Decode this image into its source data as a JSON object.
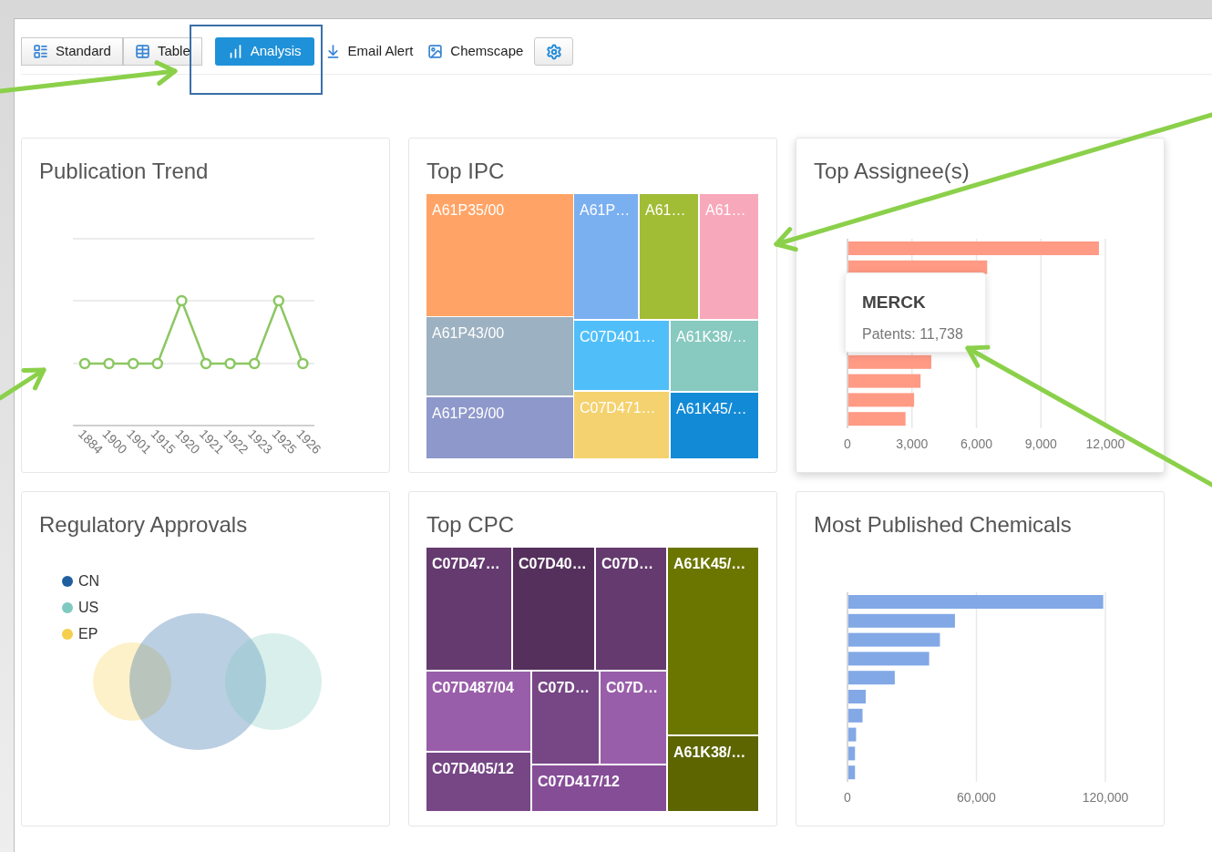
{
  "toolbar": {
    "tabs": [
      {
        "label": "Standard",
        "kind": "segment",
        "selected": false
      },
      {
        "label": "Table",
        "kind": "segment",
        "selected": false
      },
      {
        "label": "Analysis",
        "kind": "segment",
        "selected": true
      },
      {
        "label": "Email Alert",
        "kind": "link",
        "selected": false
      },
      {
        "label": "Chemscape",
        "kind": "link",
        "selected": false
      }
    ]
  },
  "cards": [
    {
      "kind": "line",
      "title": "Publication Trend",
      "x_labels": [
        "1884",
        "1900",
        "1901",
        "1915",
        "1920",
        "1921",
        "1922",
        "1923",
        "1925",
        "1926"
      ]
    },
    {
      "kind": "treemap",
      "title": "Top IPC",
      "bold_labels": false,
      "cells": [
        {
          "label": "A61P35/00",
          "color": "#ffa466"
        },
        {
          "label": "A61P…",
          "color": "#7aaff0"
        },
        {
          "label": "A61…",
          "color": "#a1bc35"
        },
        {
          "label": "A61…",
          "color": "#f8a8bb"
        },
        {
          "label": "A61P43/00",
          "color": "#9cb1c1"
        },
        {
          "label": "A61P29/00",
          "color": "#8e98cb"
        },
        {
          "label": "C07D401…",
          "color": "#50bff9"
        },
        {
          "label": "A61K38/…",
          "color": "#88c9c0"
        },
        {
          "label": "C07D471…",
          "color": "#f4d26f"
        },
        {
          "label": "A61K45/…",
          "color": "#138ad6"
        }
      ]
    },
    {
      "kind": "bar",
      "title": "Top Assignee(s)",
      "chart_data": {
        "type": "bar",
        "orientation": "horizontal",
        "grid": true,
        "series": [
          {
            "color": "#ff9a85",
            "values": [
              11700,
              6500,
              null,
              null,
              null,
              null,
              3900,
              3400,
              3100,
              2700
            ]
          }
        ],
        "xlim": [
          0,
          12000
        ],
        "xticks": [
          {
            "value": 0,
            "label": "0"
          },
          {
            "value": 3000,
            "label": "3,000"
          },
          {
            "value": 6000,
            "label": "6,000"
          },
          {
            "value": 9000,
            "label": "9,000"
          },
          {
            "value": 12000,
            "label": "12,000"
          }
        ]
      },
      "tooltip": {
        "title": "MERCK",
        "text": "Patents: 11,738"
      }
    },
    {
      "kind": "venn",
      "title": "Regulatory Approvals",
      "legend": [
        {
          "label": "CN",
          "color": "#1f5fa0"
        },
        {
          "label": "US",
          "color": "#7fc9c0"
        },
        {
          "label": "EP",
          "color": "#f5cf4c"
        }
      ]
    },
    {
      "kind": "treemap",
      "title": "Top CPC",
      "bold_labels": true,
      "cells": [
        {
          "label": "C07D47…",
          "color": "#653a6f"
        },
        {
          "label": "C07D40…",
          "color": "#55305d"
        },
        {
          "label": "C07D…",
          "color": "#653a6f"
        },
        {
          "label": "A61K45/…",
          "color": "#6b7600"
        },
        {
          "label": "C07D487/04",
          "color": "#995ea9"
        },
        {
          "label": "C07D…",
          "color": "#764685"
        },
        {
          "label": "C07D…",
          "color": "#995ea9"
        },
        {
          "label": "C07D405/12",
          "color": "#764685"
        },
        {
          "label": "C07D417/12",
          "color": "#864d97"
        },
        {
          "label": "A61K38/…",
          "color": "#5c6500"
        }
      ]
    },
    {
      "kind": "bar",
      "title": "Most Published Chemicals",
      "chart_data": {
        "type": "bar",
        "orientation": "horizontal",
        "grid": true,
        "series": [
          {
            "color": "#82a8e6",
            "values": [
              119000,
              50000,
              43000,
              38000,
              22000,
              8500,
              7000,
              4000,
              3500,
              3500
            ]
          }
        ],
        "xlim": [
          0,
          120000
        ],
        "xticks": [
          {
            "value": 0,
            "label": "0"
          },
          {
            "value": 60000,
            "label": "60,000"
          },
          {
            "value": 120000,
            "label": "120,000"
          }
        ]
      }
    }
  ]
}
